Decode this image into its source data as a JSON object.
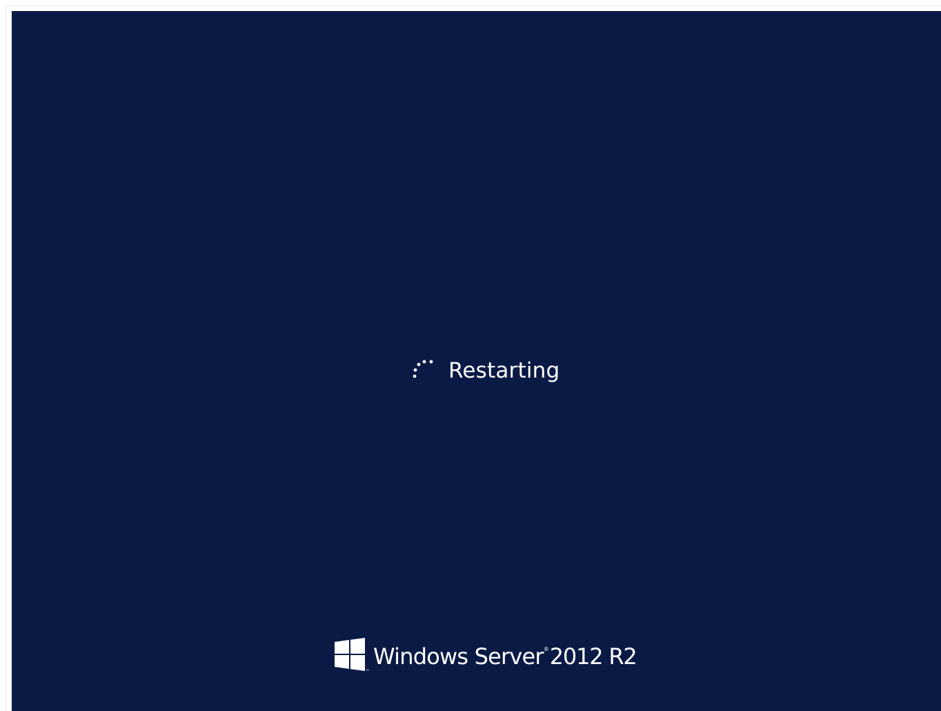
{
  "screen": {
    "background_color": "#0b1a45",
    "text_color": "#ffffff"
  },
  "status": {
    "spinner_icon": "loading-dots-icon",
    "text": "Restarting"
  },
  "branding": {
    "logo_icon": "windows-logo-icon",
    "trademark": "™",
    "product_prefix": "Windows Server",
    "registered": "®",
    "product_version": "2012 R2"
  }
}
